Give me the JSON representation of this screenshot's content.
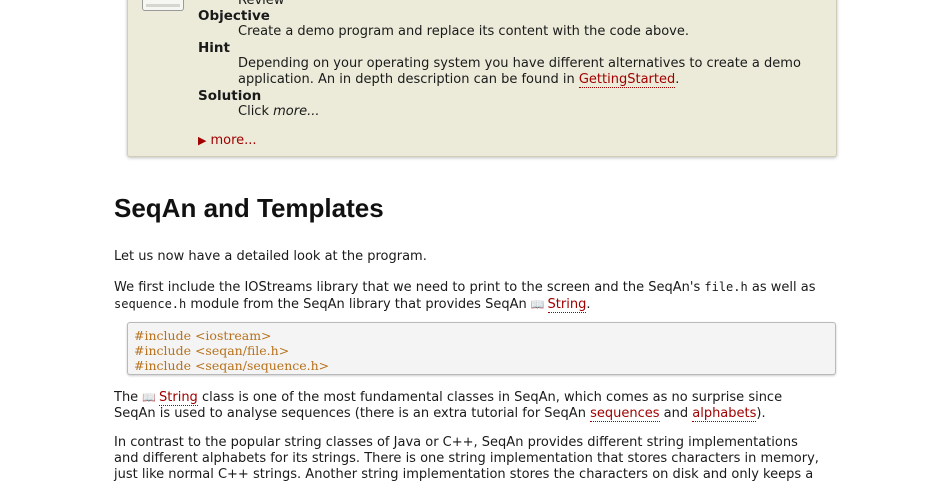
{
  "assignment": {
    "partial_top": "Review",
    "objective_label": "Objective",
    "objective_text": "Create a demo program and replace its content with the code above.",
    "hint_label": "Hint",
    "hint_line1": "Depending on your operating system you have different alternatives to create a demo",
    "hint_line2_pre": "application. An in depth description can be found in ",
    "hint_link": "GettingStarted",
    "hint_line2_post": ".",
    "solution_label": "Solution",
    "solution_pre": "Click ",
    "solution_em": "more...",
    "more_triangle": "▶",
    "more_label": "more..."
  },
  "section": {
    "title": "SeqAn and Templates",
    "p1": "Let us now have a detailed look at the program.",
    "p2_a": "We first include the IOStreams library that we need to print to the screen and the SeqAn's ",
    "p2_code1": "file.h",
    "p2_b": " as well as",
    "p2_code2": "sequence.h",
    "p2_c": " module from the SeqAn library that provides SeqAn ",
    "p2_link": "String",
    "p2_d": ".",
    "code_lines": [
      "#include <iostream>",
      "#include <seqan/file.h>",
      "#include <seqan/sequence.h>"
    ],
    "p3_a": "The ",
    "p3_link": "String",
    "p3_b": " class is one of the most fundamental classes in SeqAn, which comes as no surprise since",
    "p3_c": "SeqAn is used to analyse sequences (there is an extra tutorial for SeqAn ",
    "p3_link2": "sequences",
    "p3_d": " and ",
    "p3_link3": "alphabets",
    "p3_e": ").",
    "p4_line1": "In contrast to the popular string classes of Java or C++, SeqAn provides different string implementations",
    "p4_line2": "and different alphabets for its strings. There is one string implementation that stores characters in memory,",
    "p4_line3": "just like normal C++ strings. Another string implementation stores the characters on disk and only keeps a"
  },
  "colors": {
    "link": "#a00000",
    "assignment_bg": "#ecebd9",
    "code_text": "#b7711b"
  },
  "icons": {
    "assignment": "assignment-icon",
    "book": "book-icon",
    "triangle": "triangle-right-icon"
  }
}
